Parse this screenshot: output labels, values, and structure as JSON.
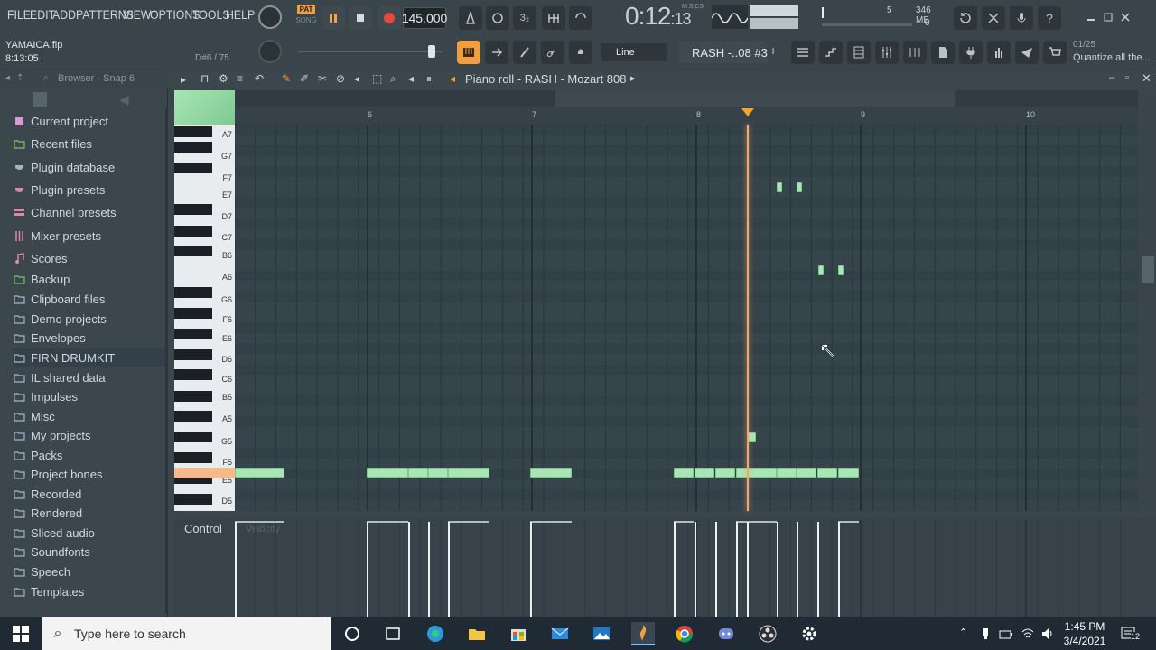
{
  "menu": {
    "items": [
      "FILE",
      "EDIT",
      "ADD",
      "PATTERNS",
      "VIEW",
      "OPTIONS",
      "TOOLS",
      "HELP"
    ]
  },
  "transport": {
    "pat_label": "PAT",
    "song_label": "SONG",
    "bpm": "145.000",
    "time": "0:12",
    "time_sub": ":13",
    "time_mode": "M:S:CS",
    "cpu": "5",
    "memory": "346 MB",
    "polyphony": "0"
  },
  "project": {
    "filename": "YAMAICA.flp",
    "position": "8:13:05",
    "pattern_count": "D#6 / 75"
  },
  "toolbar2": {
    "snap_mode": "Line",
    "channel": "RASH -..08 #3",
    "hint_counter": "01/25",
    "hint_text": "Quantize all the..."
  },
  "browser": {
    "title": "Browser - Snap 6",
    "items": [
      {
        "label": "Current project",
        "icon": "project-icon",
        "color": "#d79ad2"
      },
      {
        "label": "Recent files",
        "icon": "folder-icon",
        "color": "#7fc46c"
      },
      {
        "label": "Plugin database",
        "icon": "plug-icon",
        "color": "#9fb6c4"
      },
      {
        "label": "Plugin presets",
        "icon": "plug-icon",
        "color": "#d68aa6"
      },
      {
        "label": "Channel presets",
        "icon": "channel-icon",
        "color": "#d68aa6"
      },
      {
        "label": "Mixer presets",
        "icon": "mixer-icon",
        "color": "#d68aa6"
      },
      {
        "label": "Scores",
        "icon": "note-icon",
        "color": "#d68aa6"
      },
      {
        "label": "Backup",
        "icon": "folder-icon",
        "color": "#7fc46c"
      },
      {
        "label": "Clipboard files",
        "icon": "folder-icon",
        "color": "#9fb6c4"
      },
      {
        "label": "Demo projects",
        "icon": "folder-icon",
        "color": "#9fb6c4"
      },
      {
        "label": "Envelopes",
        "icon": "folder-icon",
        "color": "#9fb6c4"
      },
      {
        "label": "FIRN DRUMKIT",
        "icon": "folder-icon",
        "color": "#9fb6c4"
      },
      {
        "label": "IL shared data",
        "icon": "folder-icon",
        "color": "#9fb6c4"
      },
      {
        "label": "Impulses",
        "icon": "folder-icon",
        "color": "#9fb6c4"
      },
      {
        "label": "Misc",
        "icon": "folder-icon",
        "color": "#9fb6c4"
      },
      {
        "label": "My projects",
        "icon": "folder-icon",
        "color": "#9fb6c4"
      },
      {
        "label": "Packs",
        "icon": "folder-icon",
        "color": "#9fb6c4"
      },
      {
        "label": "Project bones",
        "icon": "folder-icon",
        "color": "#9fb6c4"
      },
      {
        "label": "Recorded",
        "icon": "folder-icon",
        "color": "#9fb6c4"
      },
      {
        "label": "Rendered",
        "icon": "folder-icon",
        "color": "#9fb6c4"
      },
      {
        "label": "Sliced audio",
        "icon": "folder-icon",
        "color": "#9fb6c4"
      },
      {
        "label": "Soundfonts",
        "icon": "folder-icon",
        "color": "#9fb6c4"
      },
      {
        "label": "Speech",
        "icon": "folder-icon",
        "color": "#9fb6c4"
      },
      {
        "label": "Templates",
        "icon": "folder-icon",
        "color": "#9fb6c4"
      }
    ]
  },
  "piano_roll": {
    "title": "Piano roll - RASH - Mozart 808",
    "bars": [
      "6",
      "7",
      "8",
      "9",
      "10"
    ],
    "key_labels": [
      "A7",
      "G7",
      "F7",
      "E7",
      "D7",
      "C7",
      "B6",
      "A6",
      "G6",
      "F6",
      "E6",
      "D6",
      "C6",
      "B5",
      "A5",
      "G5",
      "F5",
      "E5",
      "D5"
    ],
    "control_label": "Control",
    "control_target": "Velocity"
  },
  "taskbar": {
    "search_placeholder": "Type here to search",
    "time": "1:45 PM",
    "date": "3/4/2021",
    "notification_count": "12"
  }
}
